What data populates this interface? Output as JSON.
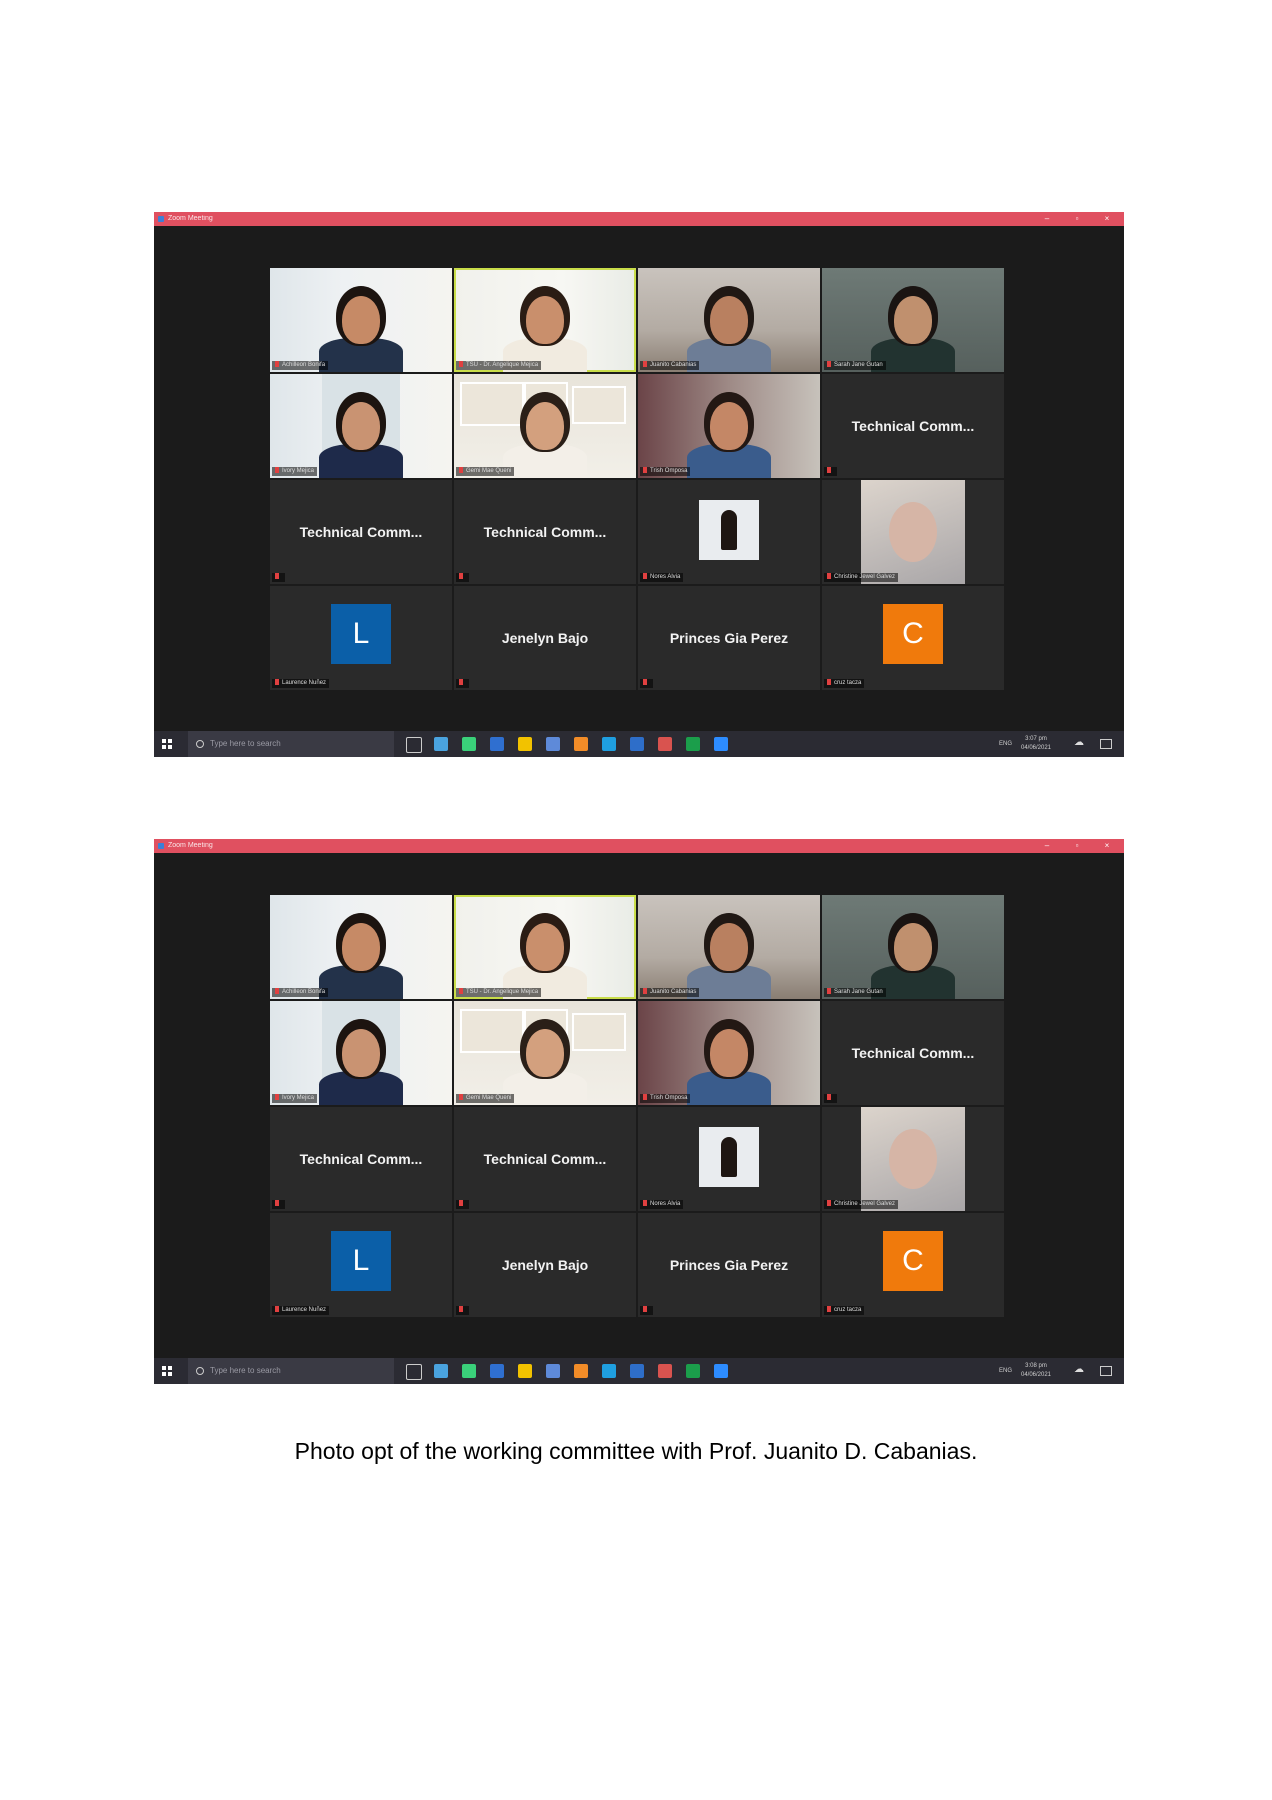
{
  "window": {
    "app_title": "Zoom Meeting",
    "controls": [
      "–",
      "▫",
      "×"
    ]
  },
  "screens": [
    {
      "clock": {
        "time": "3:07 pm",
        "date": "04/06/2021"
      },
      "tiles": [
        {
          "kind": "video",
          "label": "Achilleon Bonifa",
          "speaking": false
        },
        {
          "kind": "video",
          "label": "TSU - Dr. Angelique Mejica",
          "speaking": true
        },
        {
          "kind": "video",
          "label": "Juanito Cabanias",
          "speaking": false
        },
        {
          "kind": "video",
          "label": "Sarah Jane Gutan",
          "speaking": false
        },
        {
          "kind": "video",
          "label": "Ivory Mejica",
          "speaking": false
        },
        {
          "kind": "video",
          "label": "Gemi Mae Queni",
          "speaking": false
        },
        {
          "kind": "video",
          "label": "Trish Omposa",
          "speaking": false
        },
        {
          "kind": "name",
          "caption": "Technical Comm...",
          "label": ""
        },
        {
          "kind": "name",
          "caption": "Technical Comm...",
          "label": ""
        },
        {
          "kind": "name",
          "caption": "Technical Comm...",
          "label": ""
        },
        {
          "kind": "photo",
          "label": "Nores Alvia"
        },
        {
          "kind": "photo2",
          "label": "Christine Jewel Galvez"
        },
        {
          "kind": "letter",
          "letter": "L",
          "color": "#0b5fa8",
          "label": "Laurence Nuñez"
        },
        {
          "kind": "name",
          "caption": "Jenelyn Bajo",
          "label": ""
        },
        {
          "kind": "name",
          "caption": "Princes Gia Perez",
          "label": ""
        },
        {
          "kind": "letter",
          "letter": "C",
          "color": "#f07a0c",
          "label": "cruz tacza"
        }
      ]
    },
    {
      "clock": {
        "time": "3:08 pm",
        "date": "04/06/2021"
      },
      "tiles": [
        {
          "kind": "video",
          "label": "Achilleon Bonifa",
          "speaking": false
        },
        {
          "kind": "video",
          "label": "TSU - Dr. Angelique Mejica",
          "speaking": true
        },
        {
          "kind": "video",
          "label": "Juanito Cabanias",
          "speaking": false
        },
        {
          "kind": "video",
          "label": "Sarah Jane Gutan",
          "speaking": false
        },
        {
          "kind": "video",
          "label": "Ivory Mejica",
          "speaking": false
        },
        {
          "kind": "video",
          "label": "Gemi Mae Queni",
          "speaking": false
        },
        {
          "kind": "video",
          "label": "Trish Omposa",
          "speaking": false
        },
        {
          "kind": "name",
          "caption": "Technical Comm...",
          "label": ""
        },
        {
          "kind": "name",
          "caption": "Technical Comm...",
          "label": ""
        },
        {
          "kind": "name",
          "caption": "Technical Comm...",
          "label": ""
        },
        {
          "kind": "photo",
          "label": "Nores Alvia"
        },
        {
          "kind": "photo2",
          "label": "Christine Jewel Galvez"
        },
        {
          "kind": "letter",
          "letter": "L",
          "color": "#0b5fa8",
          "label": "Laurence Nuñez"
        },
        {
          "kind": "name",
          "caption": "Jenelyn Bajo",
          "label": ""
        },
        {
          "kind": "name",
          "caption": "Princes Gia Perez",
          "label": ""
        },
        {
          "kind": "letter",
          "letter": "C",
          "color": "#f07a0c",
          "label": "cruz tacza"
        }
      ]
    }
  ],
  "taskbar": {
    "search_placeholder": "Type here to search",
    "language": "ENG",
    "apps": [
      "#4aa3df",
      "#3ad07a",
      "#2f6fd0",
      "#f2c200",
      "#5e8ad9",
      "#f28c28",
      "#1f9fe0",
      "#2e6ec9",
      "#d9534f",
      "#1b9e4b",
      "#2d8cff"
    ],
    "app_icons": [
      "taskview-icon",
      "mail-icon",
      "spotify-icon",
      "files-icon",
      "sticky-notes-icon",
      "calendar-icon",
      "firefox-icon",
      "edge-icon",
      "word-icon",
      "chrome-icon",
      "excel-icon",
      "zoom-icon"
    ]
  },
  "caption": "Photo opt of the working committee with Prof. Juanito D. Cabanias."
}
